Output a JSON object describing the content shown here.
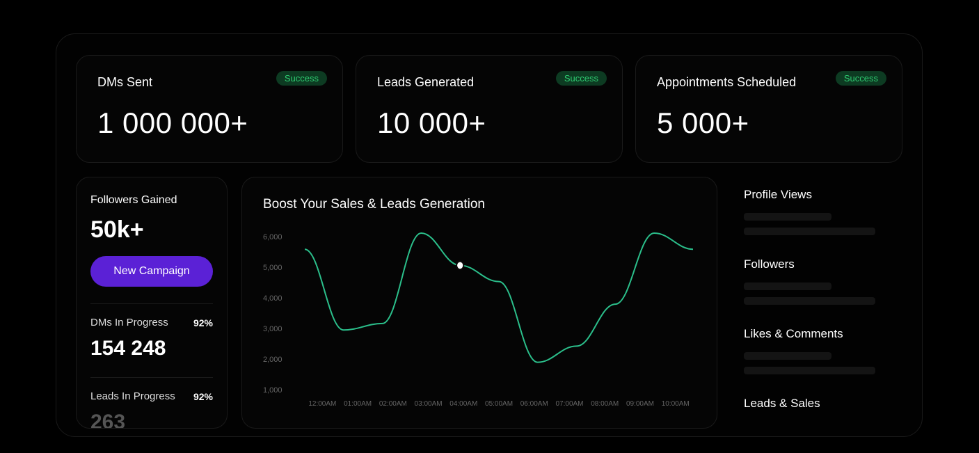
{
  "kpis": [
    {
      "title": "DMs Sent",
      "value": "1 000 000+",
      "badge": "Success"
    },
    {
      "title": "Leads Generated",
      "value": "10 000+",
      "badge": "Success"
    },
    {
      "title": "Appointments Scheduled",
      "value": "5 000+",
      "badge": "Success"
    }
  ],
  "left": {
    "followers_title": "Followers Gained",
    "followers_value": "50k+",
    "button": "New Campaign",
    "dms_label": "DMs In Progress",
    "dms_pct": "92%",
    "dms_value": "154 248",
    "leads_label": "Leads In Progress",
    "leads_pct": "92%",
    "leads_value": "263"
  },
  "chart_title": "Boost Your Sales & Leads Generation",
  "chart_data": {
    "type": "line",
    "title": "Boost Your Sales & Leads Generation",
    "xlabel": "",
    "ylabel": "",
    "ylim": [
      1000,
      6000
    ],
    "categories": [
      "12:00AM",
      "01:00AM",
      "02:00AM",
      "03:00AM",
      "04:00AM",
      "05:00AM",
      "06:00AM",
      "07:00AM",
      "08:00AM",
      "09:00AM",
      "10:00AM"
    ],
    "values": [
      5500,
      3000,
      3200,
      6000,
      5000,
      4500,
      2000,
      2500,
      3800,
      6000,
      5500
    ],
    "highlight_index": 4
  },
  "right": {
    "sections": [
      "Profile Views",
      "Followers",
      "Likes & Comments",
      "Leads & Sales"
    ]
  }
}
